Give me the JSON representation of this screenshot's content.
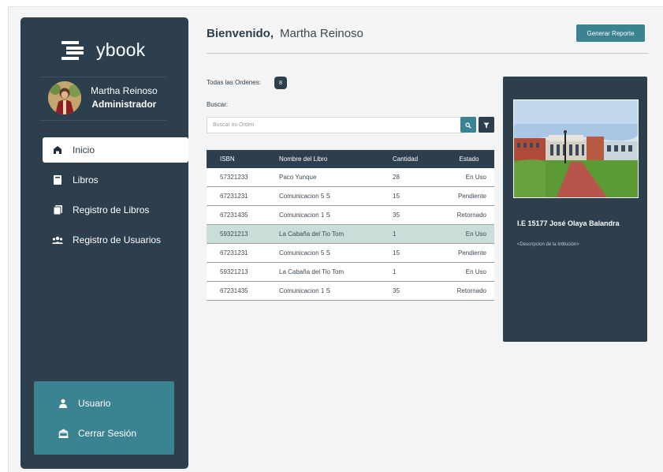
{
  "app": {
    "brand": "ybook"
  },
  "user": {
    "name": "Martha Reinoso",
    "role": "Administrador"
  },
  "sidebar": {
    "items": [
      {
        "label": "Inicio",
        "icon": "home-icon",
        "active": true
      },
      {
        "label": "Libros",
        "icon": "book-icon",
        "active": false
      },
      {
        "label": "Registro de Libros",
        "icon": "books-register-icon",
        "active": false
      },
      {
        "label": "Registro de Usuarios",
        "icon": "users-register-icon",
        "active": false
      }
    ],
    "bottom": [
      {
        "label": "Usuario",
        "icon": "user-icon"
      },
      {
        "label": "Cerrar Sesión",
        "icon": "logout-icon"
      }
    ]
  },
  "header": {
    "greeting": "Bienvenido,",
    "name": "Martha Reinoso",
    "report_button": "Generar Reporte"
  },
  "orders": {
    "label": "Todas las Ordenes:",
    "count": "8",
    "search_label": "Buscar:",
    "search_placeholder": "Buscar mi Orden",
    "columns": [
      "ISBN",
      "Nombre del Libro",
      "Cantidad",
      "Estado"
    ],
    "rows": [
      [
        "57321233",
        "Paco Yunque",
        "28",
        "En Uso"
      ],
      [
        "67231231",
        "Comunicacion 5 S",
        "15",
        "Pendiente"
      ],
      [
        "67231435",
        "Comunicacion 1 S",
        "35",
        "Retornado"
      ],
      [
        "59321213",
        "La Cabaña del Tio Tom",
        "1",
        "En Uso"
      ],
      [
        "67231231",
        "Comunicacion 5 S",
        "15",
        "Pendiente"
      ],
      [
        "59321213",
        "La Cabaña del Tio Tom",
        "1",
        "En Uso"
      ],
      [
        "67231435",
        "Comunicacion 1 S",
        "35",
        "Retornado"
      ]
    ],
    "selected_row": 3
  },
  "institution": {
    "name": "I.E 15177 José Olaya Balandra",
    "description": "<Descripcion de la Intitución>"
  },
  "colors": {
    "sidebar": "#2d3e4d",
    "accent": "#3c8391",
    "selected_row": "#c9ded9"
  }
}
